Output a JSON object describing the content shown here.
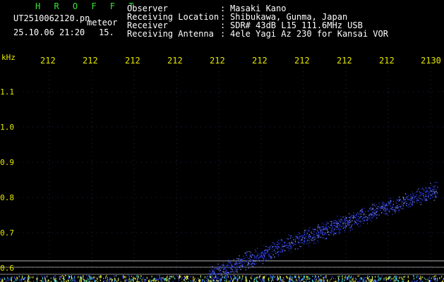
{
  "header": {
    "brand": "H R O F F T",
    "file_name": "UT2510062120.pn",
    "object_type": "meteor",
    "datetime": "25.10.06 21:20",
    "value": "15.",
    "fields": [
      {
        "label": "Observer",
        "value": "Masaki Kano"
      },
      {
        "label": "Receiving Location",
        "value": "Shibukawa, Gunma, Japan"
      },
      {
        "label": "Receiver",
        "value": "SDR# 43dB L15 111.6MHz USB"
      },
      {
        "label": "Receiving Antenna",
        "value": "4ele Yagi Az 230 for Kansai VOR"
      }
    ]
  },
  "axis": {
    "y_unit": "kHz",
    "y_ticks": [
      "1.1",
      "1.0",
      "0.9",
      "0.8",
      "0.7",
      "0.6"
    ],
    "x_ticks": [
      "212",
      "212",
      "212",
      "212",
      "212",
      "212",
      "212",
      "212",
      "212",
      "2130"
    ]
  },
  "colors": {
    "background": "#000000",
    "header_text": "#ffffff",
    "brand": "#37e337",
    "axis_text": "#e6e600",
    "trace": "#3a4cff",
    "noise": "#ffff40",
    "grid": "#24244a"
  }
}
